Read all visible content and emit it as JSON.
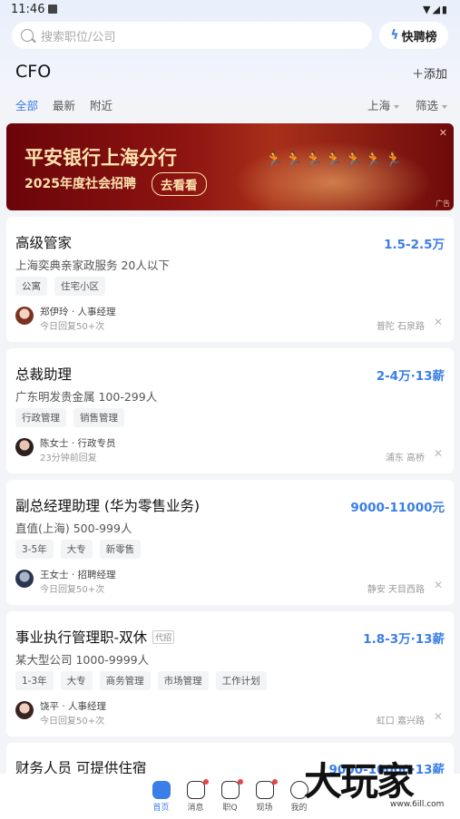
{
  "status": {
    "time": "11:46"
  },
  "search": {
    "placeholder": "搜索职位/公司"
  },
  "quick": {
    "label": "快聘榜"
  },
  "header": {
    "title": "CFO",
    "add": "添加"
  },
  "tabs": [
    "全部",
    "最新",
    "附近"
  ],
  "filters": {
    "city": "上海",
    "filter": "筛选"
  },
  "banner": {
    "title": "平安银行上海分行",
    "subtitle": "2025年度社会招聘",
    "button": "去看看",
    "ad": "广告"
  },
  "jobs": [
    {
      "title": "高级管家",
      "salary": "1.5-2.5万",
      "company": "上海奕典亲家政服务  20人以下",
      "tags": [
        "公寓",
        "住宅小区"
      ],
      "recruiter": "郑伊玲 · 人事经理",
      "reply": "今日回复50+次",
      "location": "普陀 石泉路"
    },
    {
      "title": "总裁助理",
      "salary": "2-4万·13薪",
      "company": "广东明发贵金属  100-299人",
      "tags": [
        "行政管理",
        "销售管理"
      ],
      "recruiter": "陈女士 · 行政专员",
      "reply": "23分钟前回复",
      "location": "浦东 高桥"
    },
    {
      "title": "副总经理助理 (华为零售业务)",
      "salary": "9000-11000元",
      "company": "直值(上海)  500-999人",
      "tags": [
        "3-5年",
        "大专",
        "新零售"
      ],
      "recruiter": "王女士 · 招聘经理",
      "reply": "今日回复50+次",
      "location": "静安 天目西路"
    },
    {
      "title": "事业执行管理职-双休",
      "agent": "代招",
      "salary": "1.8-3万·13薪",
      "company": "某大型公司  1000-9999人",
      "tags": [
        "1-3年",
        "大专",
        "商务管理",
        "市场管理",
        "工作计划"
      ],
      "recruiter": "饶平 · 人事经理",
      "reply": "今日回复50+次",
      "location": "虹口 嘉兴路"
    }
  ],
  "partial": {
    "title": "财务人员 可提供住宿",
    "salary": "9000-10000·13薪"
  },
  "nav": [
    "首页",
    "消息",
    "职Q",
    "现场",
    "我的"
  ],
  "watermark": {
    "main": "大玩家",
    "sub": "www.6ill.com"
  }
}
